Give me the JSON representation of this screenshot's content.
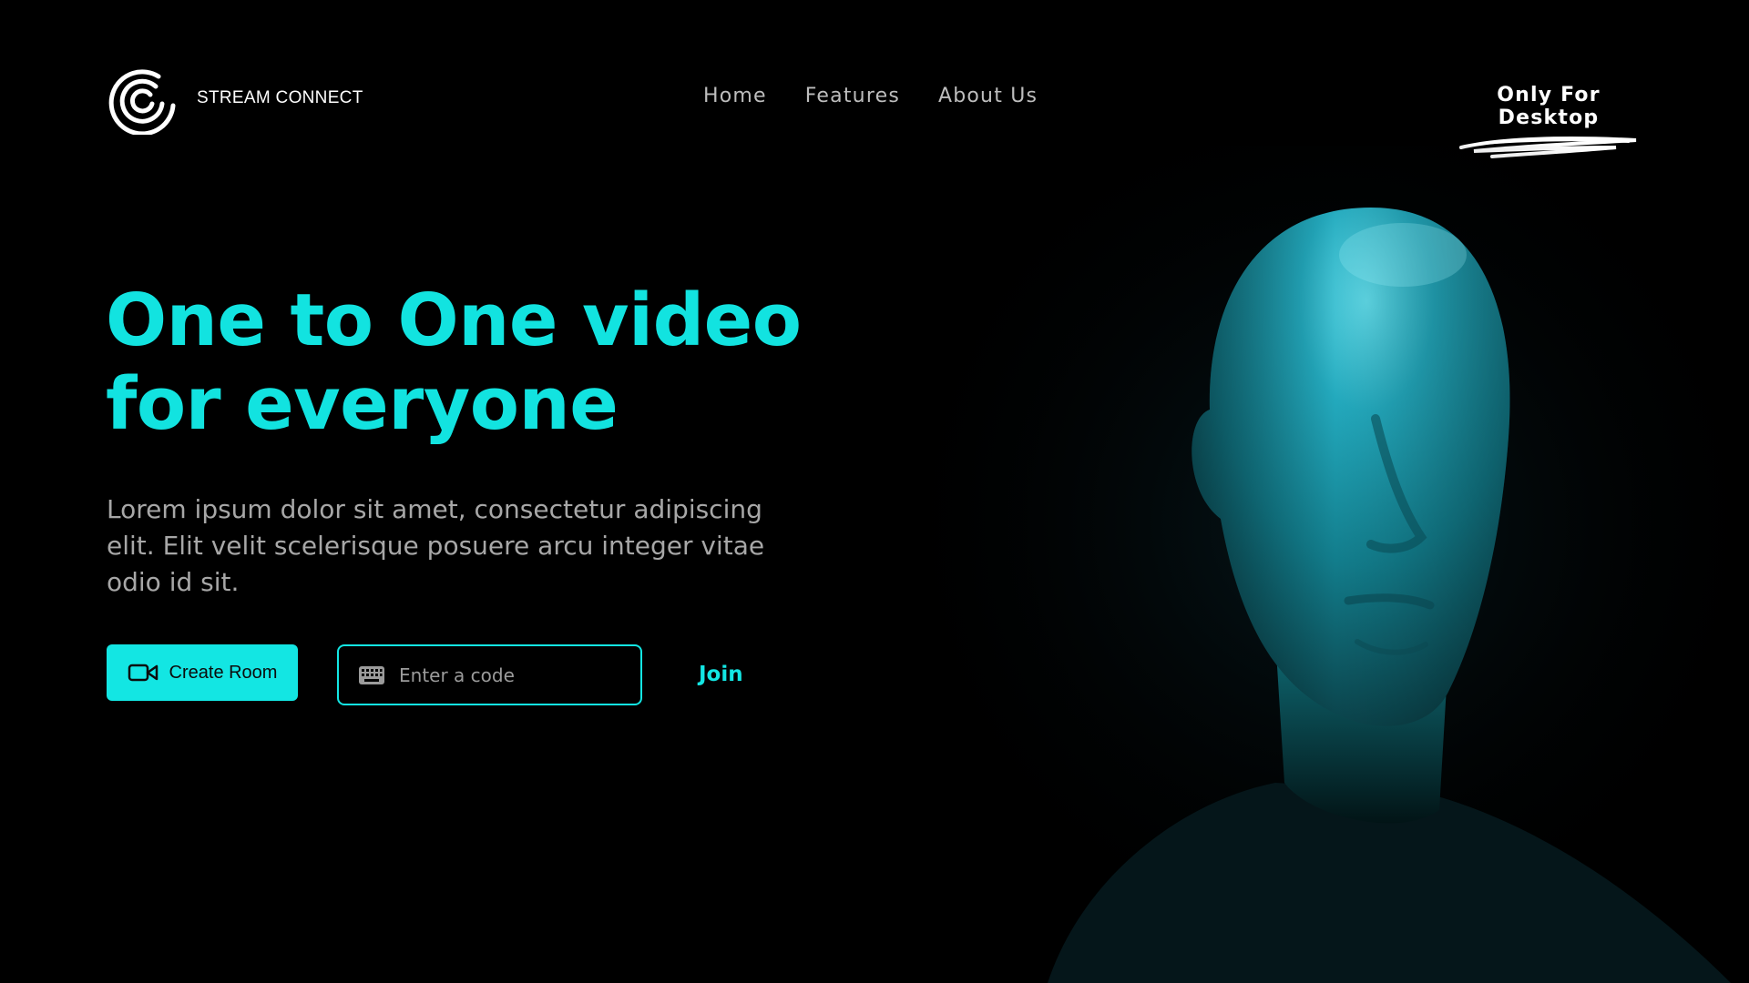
{
  "brand": {
    "name": "STREAM CONNECT",
    "logo_icon": "concentric-swirl-icon"
  },
  "nav": {
    "items": [
      {
        "label": "Home"
      },
      {
        "label": "Features"
      },
      {
        "label": "About Us"
      }
    ]
  },
  "badge": {
    "label": "Only For Desktop"
  },
  "hero": {
    "title": "One to One video for everyone",
    "description": "Lorem ipsum dolor sit amet, consectetur adipiscing elit. Elit velit scelerisque posuere arcu integer vitae odio id sit."
  },
  "actions": {
    "create_room": {
      "label": "Create Room",
      "icon": "video-camera-icon"
    },
    "code_input": {
      "placeholder": "Enter a code",
      "icon": "keyboard-icon",
      "value": ""
    },
    "join": {
      "label": "Join"
    }
  },
  "colors": {
    "accent": "#13e6e3",
    "background": "#000000",
    "body_text": "#a7a7a7",
    "nav_text": "#bdbdbd"
  }
}
